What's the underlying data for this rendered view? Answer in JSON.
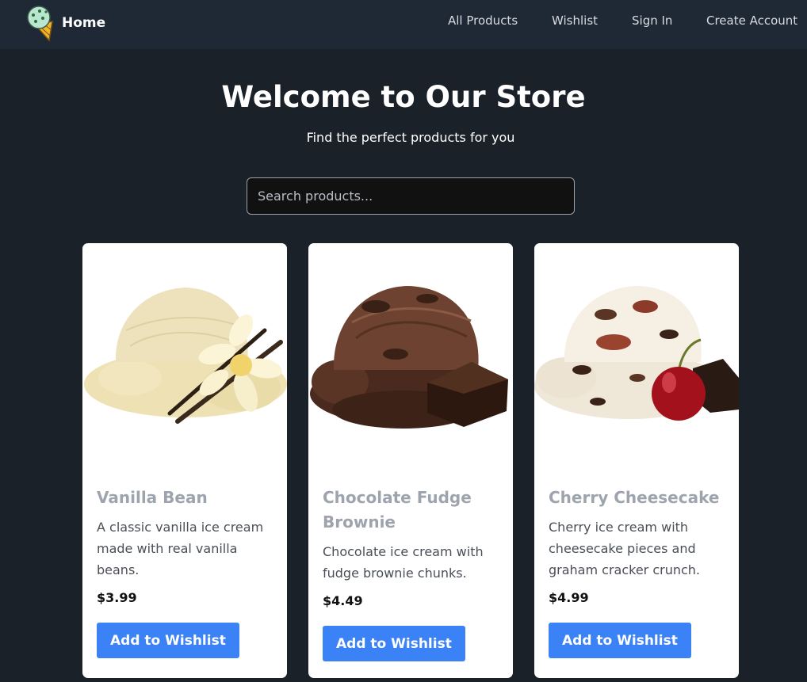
{
  "nav": {
    "home": "Home",
    "links": [
      "All Products",
      "Wishlist",
      "Sign In",
      "Create Account"
    ]
  },
  "hero": {
    "title": "Welcome to Our Store",
    "subtitle": "Find the perfect products for you"
  },
  "search": {
    "placeholder": "Search products..."
  },
  "products": [
    {
      "title": "Vanilla Bean",
      "description": "A classic vanilla ice cream made with real vanilla beans.",
      "price": "$3.99",
      "button": "Add to Wishlist",
      "image_icon": "vanilla-ice-cream-scoop"
    },
    {
      "title": "Chocolate Fudge Brownie",
      "description": "Chocolate ice cream with fudge brownie chunks.",
      "price": "$4.49",
      "button": "Add to Wishlist",
      "image_icon": "chocolate-ice-cream-scoop"
    },
    {
      "title": "Cherry Cheesecake",
      "description": "Cherry ice cream with cheesecake pieces and graham cracker crunch.",
      "price": "$4.99",
      "button": "Add to Wishlist",
      "image_icon": "cherry-ice-cream-scoop"
    }
  ],
  "colors": {
    "background": "#1b2129",
    "navbar": "#1f2835",
    "button": "#3b82f6",
    "card_title": "#9ea4ad"
  }
}
